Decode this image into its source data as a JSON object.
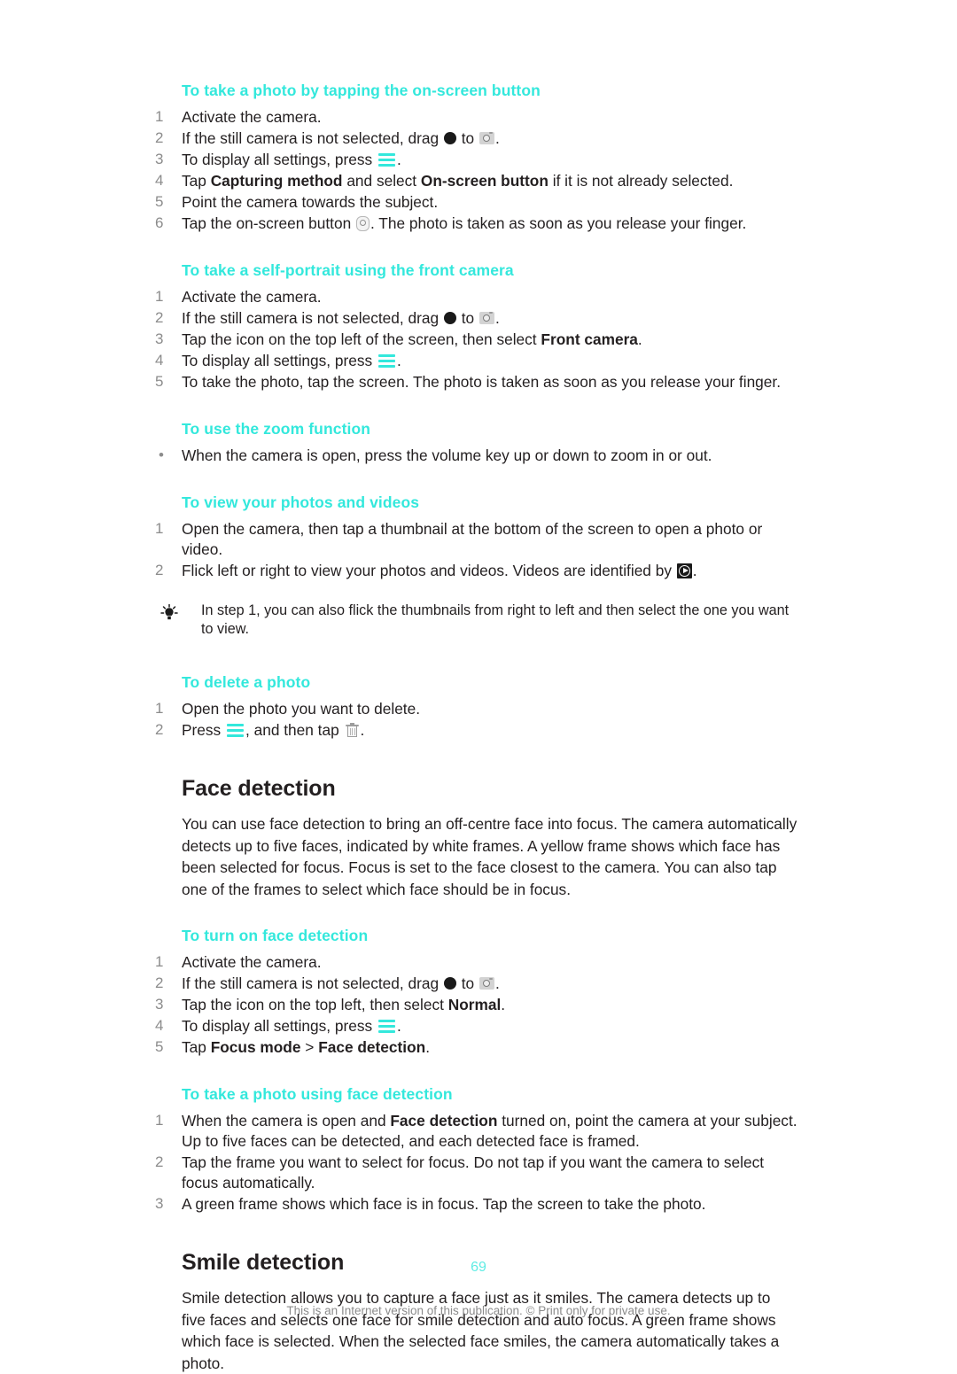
{
  "document": {
    "page_number": "69",
    "footnote": "This is an Internet version of this publication. © Print only for private use.",
    "accent_color": "#33e8dc",
    "text_color": "#231f20",
    "number_color": "#8c8c8c"
  },
  "sections": {
    "onscreen_button": {
      "heading": "To take a photo by tapping the on-screen button",
      "steps": [
        {
          "num": "1",
          "parts": [
            "Activate the camera."
          ]
        },
        {
          "num": "2",
          "parts": [
            "If the still camera is not selected, drag ",
            "[dot-icon]",
            " to ",
            "[camera-icon]",
            "."
          ]
        },
        {
          "num": "3",
          "parts": [
            "To display all settings, press ",
            "[menu-icon]",
            "."
          ]
        },
        {
          "num": "4",
          "parts": [
            "Tap ",
            "Capturing method",
            " and select ",
            "On-screen button",
            " if it is not already selected."
          ]
        },
        {
          "num": "5",
          "parts": [
            "Point the camera towards the subject."
          ]
        },
        {
          "num": "6",
          "parts": [
            "Tap the on-screen button ",
            "[onscreen-button-icon]",
            ". The photo is taken as soon as you release your finger."
          ]
        }
      ],
      "step1": "Activate the camera.",
      "step2_a": "If the still camera is not selected, drag",
      "step2_b": "to",
      "step2_c": ".",
      "step3_a": "To display all settings, press",
      "step3_b": ".",
      "step4_a": "Tap",
      "step4_bold1": "Capturing method",
      "step4_b": "and select",
      "step4_bold2": "On-screen button",
      "step4_c": "if it is not already selected.",
      "step5": "Point the camera towards the subject.",
      "step6_a": "Tap the on-screen button",
      "step6_b": ". The photo is taken as soon as you release your finger."
    },
    "self_portrait": {
      "heading": "To take a self-portrait using the front camera",
      "step1": "Activate the camera.",
      "step2_a": "If the still camera is not selected, drag",
      "step2_b": "to",
      "step2_c": ".",
      "step3_a": "Tap the icon on the top left of the screen, then select",
      "step3_bold": "Front camera",
      "step3_b": ".",
      "step4_a": "To display all settings, press",
      "step4_b": ".",
      "step5": "To take the photo, tap the screen. The photo is taken as soon as you release your finger."
    },
    "zoom_function": {
      "heading": "To use the zoom function",
      "bullet": "When the camera is open, press the volume key up or down to zoom in or out."
    },
    "view_photos": {
      "heading": "To view your photos and videos",
      "step1": "Open the camera, then tap a thumbnail at the bottom of the screen to open a photo or video.",
      "step2_a": "Flick left or right to view your photos and videos. Videos are identified by",
      "step2_b": "."
    },
    "tip": {
      "text": "In step 1, you can also flick the thumbnails from right to left and then select the one you want to view.",
      "icon": "lightbulb-icon"
    },
    "delete_photo": {
      "heading": "To delete a photo",
      "step1": "Open the photo you want to delete.",
      "step2_a": "Press",
      "step2_b": ", and then tap",
      "step2_c": "."
    },
    "face_detection": {
      "heading": "Face detection",
      "body": "You can use face detection to bring an off-centre face into focus. The camera automatically detects up to five faces, indicated by white frames. A yellow frame shows which face has been selected for focus. Focus is set to the face closest to the camera. You can also tap one of the frames to select which face should be in focus."
    },
    "turn_on_face_detection": {
      "heading": "To turn on face detection",
      "step1": "Activate the camera.",
      "step2_a": "If the still camera is not selected, drag",
      "step2_b": "to",
      "step2_c": ".",
      "step3_a": "Tap the icon on the top left, then select",
      "step3_bold": "Normal",
      "step3_b": ".",
      "step4_a": "To display all settings, press",
      "step4_b": ".",
      "step5_a": "Tap",
      "step5_bold1": "Focus mode",
      "step5_sep": ">",
      "step5_bold2": "Face detection",
      "step5_b": "."
    },
    "photo_using_face_detection": {
      "heading": "To take a photo using face detection",
      "step1_a": "When the camera is open and",
      "step1_bold": "Face detection",
      "step1_b": "turned on, point the camera at your subject. Up to five faces can be detected, and each detected face is framed.",
      "step2": "Tap the frame you want to select for focus. Do not tap if you want the camera to select focus automatically.",
      "step3": "A green frame shows which face is in focus. Tap the screen to take the photo."
    },
    "smile_detection": {
      "heading": "Smile detection",
      "body": "Smile detection allows you to capture a face just as it smiles. The camera detects up to five faces and selects one face for smile detection and auto focus. A green frame shows which face is selected. When the selected face smiles, the camera automatically takes a photo."
    }
  }
}
